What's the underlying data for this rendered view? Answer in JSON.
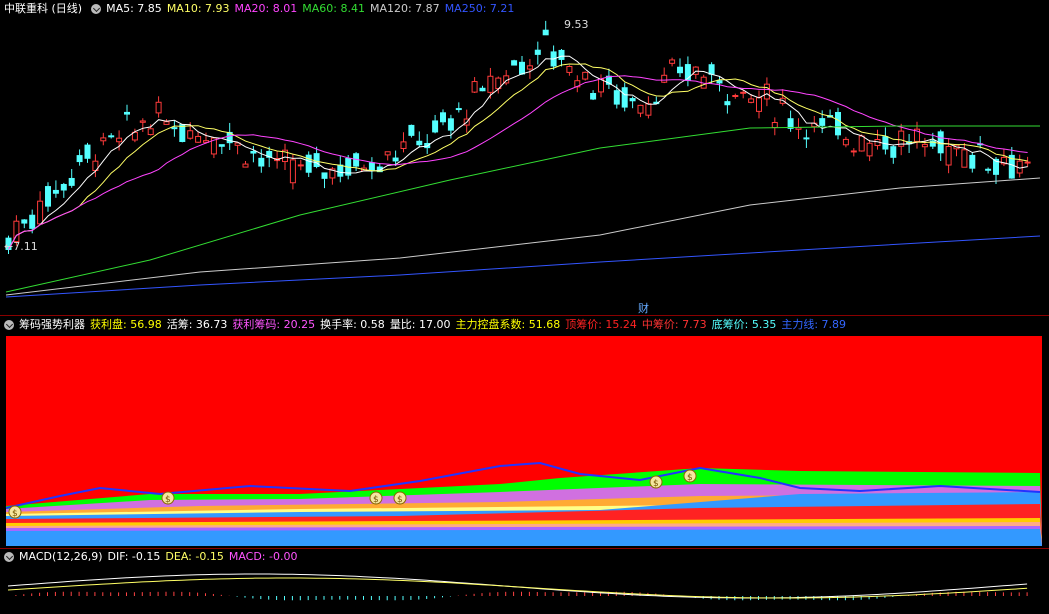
{
  "main": {
    "title": "中联重科 (日线)",
    "ma": [
      {
        "label": "MA5: 7.85",
        "color": "#ffffff"
      },
      {
        "label": "MA10: 7.93",
        "color": "#ffff66"
      },
      {
        "label": "MA20: 8.01",
        "color": "#ff44ff"
      },
      {
        "label": "MA60: 8.41",
        "color": "#33dd33"
      },
      {
        "label": "MA120: 7.87",
        "color": "#cccccc"
      },
      {
        "label": "MA250: 7.21",
        "color": "#3355ff"
      }
    ],
    "high_label": "9.53",
    "low_label": "←7.11",
    "event_marker": "财"
  },
  "chip": {
    "title": "筹码强势利器",
    "items": [
      {
        "label": "获利盘: 56.98",
        "color": "#ffff00"
      },
      {
        "label": "活筹: 36.73",
        "color": "#ffffff"
      },
      {
        "label": "获利筹码: 20.25",
        "color": "#ff55ff"
      },
      {
        "label": "换手率: 0.58",
        "color": "#ffffff"
      },
      {
        "label": "量比: 17.00",
        "color": "#ffffff"
      },
      {
        "label": "主力控盘系数: 51.68",
        "color": "#ffff00"
      },
      {
        "label": "顶筹价: 15.24",
        "color": "#ff2222"
      },
      {
        "label": "中筹价: 7.73",
        "color": "#ff3333"
      },
      {
        "label": "底筹价: 5.35",
        "color": "#55ffff"
      },
      {
        "label": "主力线: 7.89",
        "color": "#3366ff"
      }
    ]
  },
  "macd": {
    "title": "MACD(12,26,9)",
    "items": [
      {
        "label": "DIF: -0.15",
        "color": "#ffffff"
      },
      {
        "label": "DEA: -0.15",
        "color": "#ffff66"
      },
      {
        "label": "MACD: -0.00",
        "color": "#ff55ff"
      }
    ]
  }
}
